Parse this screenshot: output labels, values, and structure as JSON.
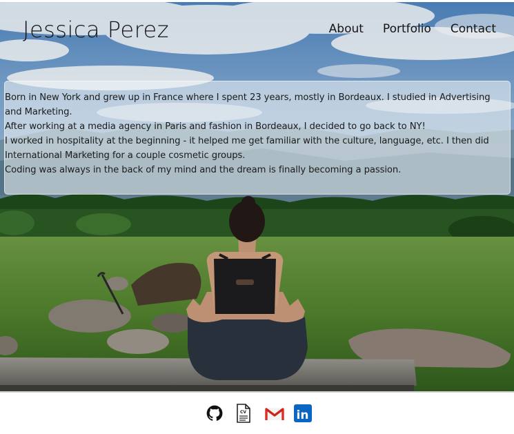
{
  "header": {
    "site_title": "Jessica Perez",
    "nav": [
      {
        "label": "About"
      },
      {
        "label": "Portfolio"
      },
      {
        "label": "Contact"
      }
    ]
  },
  "about": {
    "paragraphs": [
      "Born in New York and grew up in France where I spent 23 years, mostly in Bordeaux. I studied in Advertising and Marketing.",
      "After working at a media agency in Paris and fashion in Bordeaux, I decided to go back to NY!",
      "I worked in hospitality at the beginning - it helped me get familiar with the culture, language, etc. I then did International Marketing for a couple cosmetic groups.",
      "Coding was always in the back of my mind and the dream is finally becoming a passion."
    ]
  },
  "footer": {
    "links": [
      {
        "icon": "github-icon"
      },
      {
        "icon": "cv-document-icon",
        "label": "CV"
      },
      {
        "icon": "gmail-icon",
        "label": "M"
      },
      {
        "icon": "linkedin-icon",
        "label": "in"
      }
    ]
  },
  "colors": {
    "text": "#141414",
    "card_background": "rgba(240,244,246,0.56)",
    "gmail_red": "#d93025",
    "linkedin_blue": "#0a66c2"
  }
}
